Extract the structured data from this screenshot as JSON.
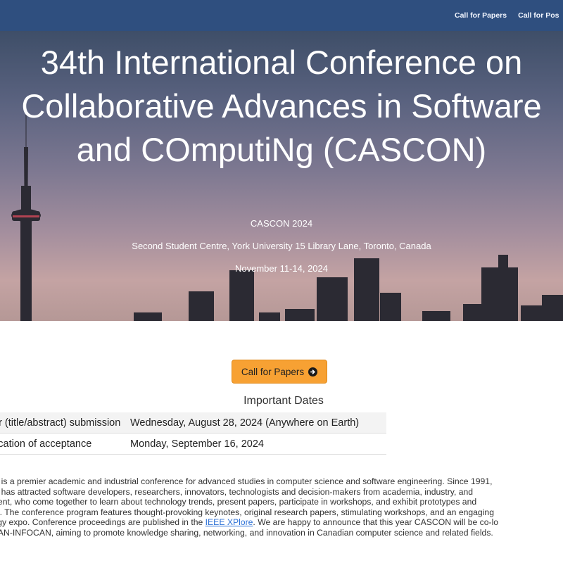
{
  "nav": {
    "items": [
      "Call for Papers",
      "Call for Pos"
    ]
  },
  "hero": {
    "title_lines": [
      "34th International Conference on",
      "Collaborative Advances in Software",
      "and COmputiNg (CASCON)"
    ],
    "event_name": "CASCON 2024",
    "location": "Second Student Centre, York University 15 Library Lane, Toronto, Canada",
    "dates": "November 11-14, 2024"
  },
  "cta": {
    "label": "Call for Papers",
    "icon": "arrow-circle-right-icon"
  },
  "important_dates": {
    "heading": "Important Dates",
    "rows": [
      {
        "label": "er (title/abstract) submission",
        "date": "Wednesday, August 28, 2024 (Anywhere on Earth)"
      },
      {
        "label": "fication of acceptance",
        "date": "Monday, September 16, 2024"
      }
    ]
  },
  "description": {
    "line1": "ON is a premier academic and industrial conference for advanced studies in computer science and software engineering. Since 1991,",
    "line2": "ON has attracted software developers, researchers, innovators, technologists and decision-makers from academia, industry, and",
    "line3": "nment, who come together to learn about technology trends, present papers, participate in workshops, and exhibit prototypes and",
    "line4": "ons. The conference program features thought-provoking keynotes, original research papers, stimulating workshops, and an engaging",
    "line5_before": "ology expo. Conference proceedings are published in the ",
    "line5_link": "IEEE XPlore",
    "line5_after": ". We are happy to announce that this year CASCON will be co-lo",
    "line6": "SCAN-INFOCAN, aiming to promote knowledge sharing, networking, and innovation in Canadian computer science and related fields."
  },
  "colors": {
    "navbar": "#2f4f7f",
    "cta": "#f7a133",
    "link": "#2a6fd6"
  }
}
